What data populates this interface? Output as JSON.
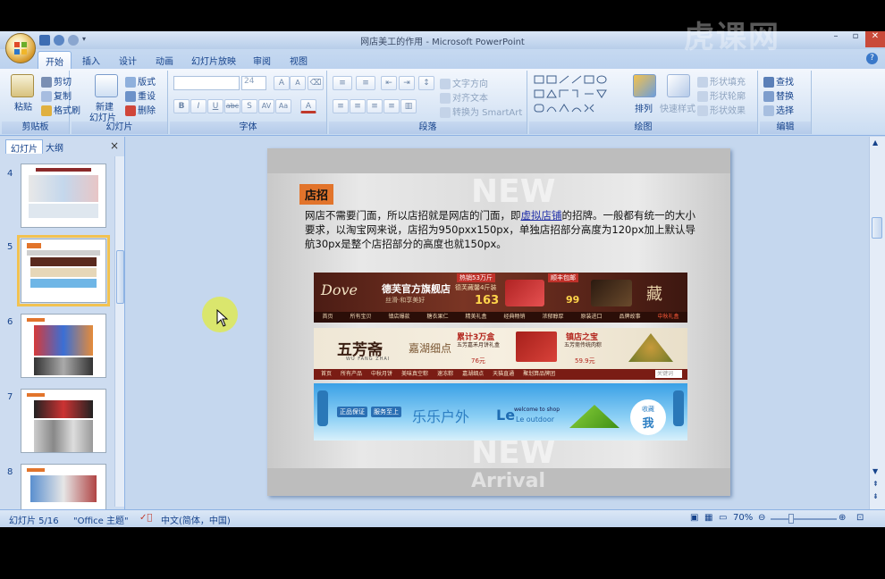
{
  "window": {
    "title": "网店美工的作用 - Microsoft PowerPoint"
  },
  "watermark": "虎课网",
  "ribbon_tabs": [
    "开始",
    "插入",
    "设计",
    "动画",
    "幻灯片放映",
    "审阅",
    "视图"
  ],
  "ribbon": {
    "clipboard": {
      "paste": "粘贴",
      "cut": "剪切",
      "copy": "复制",
      "format_painter": "格式刷",
      "title": "剪贴板"
    },
    "slides": {
      "new_slide_line1": "新建",
      "new_slide_line2": "幻灯片",
      "layout": "版式",
      "reset": "重设",
      "delete": "删除",
      "title": "幻灯片"
    },
    "font": {
      "size": "24",
      "title": "字体",
      "grow": "A",
      "shrink": "A",
      "bold": "B",
      "italic": "I",
      "underline": "U",
      "strike": "abc",
      "shadow": "S",
      "spacing": "AV",
      "case": "Aa",
      "color": "A"
    },
    "paragraph": {
      "text_direction": "文字方向",
      "align_text": "对齐文本",
      "smartart": "转换为 SmartArt",
      "title": "段落"
    },
    "drawing": {
      "arrange": "排列",
      "quick_styles": "快速样式",
      "shape_fill": "形状填充",
      "shape_outline": "形状轮廓",
      "shape_effects": "形状效果",
      "title": "绘图"
    },
    "editing": {
      "find": "查找",
      "replace": "替换",
      "select": "选择",
      "title": "编辑"
    }
  },
  "panel": {
    "tabs": [
      "幻灯片",
      "大纲"
    ],
    "close": "×",
    "thumbnails": [
      "4",
      "5",
      "6",
      "7",
      "8"
    ],
    "selected": "5"
  },
  "slide": {
    "heading": "店招",
    "body_part1": "网店不需要门面，所以店招就是网店的门面，即",
    "body_link": "虚拟店铺",
    "body_part2": "的招牌。一般都有统一的大小要求，以淘宝网来说，店招为950pxx150px，单独店招部分高度为120px加上默认导航30px是整个店招部分的高度也就150px。",
    "bg_new": "NEW",
    "bg_arrival": "Arrival",
    "banner1": {
      "brand": "Dove",
      "store": "德芙官方旗舰店",
      "tagline": "丝滑·和享美好",
      "promo": "热销53万斤",
      "sub": "德芙藏馨4斤装",
      "price": "163",
      "tag": "藏",
      "free": "顺丰包邮",
      "price2": "99",
      "nav": [
        "首页",
        "所有宝贝",
        "镇店爆款",
        "糖衣果仁",
        "精美礼盒",
        "经典畅销",
        "浓郁醇厚",
        "原装进口",
        "品牌故事",
        "中秋礼盒"
      ]
    },
    "banner2": {
      "brand": "五芳斋",
      "brand_en": "WU FANG ZHAI",
      "script": "嘉湖细点",
      "promo": "累计3万盒",
      "product": "五芳嘉禾月饼礼盒",
      "price": "76元",
      "promo2": "镇店之宝",
      "product2": "五芳斋传统肉粽",
      "price2": "59.9元",
      "nav": [
        "首页",
        "所有产品",
        "中秋月饼",
        "美味真空粽",
        "速冻粽",
        "嘉湖细点",
        "天猫直通",
        "聚划算品牌团"
      ],
      "search": "关键词"
    },
    "banner3": {
      "badge1": "正品保证",
      "badge2": "服务至上",
      "name": "乐乐户外",
      "logo": "Le",
      "welcome": "welcome to shop",
      "outdoor": "Le outdoor",
      "fav1": "收藏",
      "fav2": "我"
    }
  },
  "statusbar": {
    "slide_info": "幻灯片 5/16",
    "theme": "\"Office 主题\"",
    "language": "中文(简体，中国)",
    "zoom": "70%"
  }
}
